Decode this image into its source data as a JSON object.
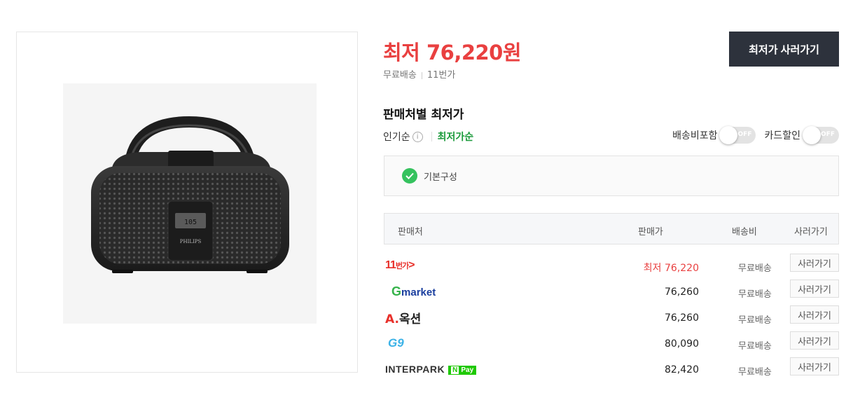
{
  "price": {
    "lowest_label": "최저 76,220원",
    "shipping": "무료배송",
    "store": "11번가"
  },
  "buy_button": "최저가 사러가기",
  "section_title": "판매처별 최저가",
  "sort": {
    "popular": "인기순",
    "info_glyph": "i",
    "lowest": "최저가순"
  },
  "toggles": [
    {
      "label": "배송비포함",
      "state": "OFF"
    },
    {
      "label": "카드할인",
      "state": "OFF"
    }
  ],
  "config": {
    "label": "기본구성"
  },
  "table": {
    "headers": {
      "seller": "판매처",
      "price": "판매가",
      "shipping": "배송비",
      "go": "사러가기"
    },
    "rows": [
      {
        "seller": "11번가",
        "logo_main": "11",
        "logo_sub": "번가",
        "price": "최저 76,220",
        "shipping": "무료배송",
        "go": "사러가기"
      },
      {
        "seller": "Gmarket",
        "logo_main": "G",
        "logo_sub": "market",
        "price": "76,260",
        "shipping": "무료배송",
        "go": "사러가기"
      },
      {
        "seller": "옥션",
        "logo_main": "A.",
        "logo_sub": "옥션",
        "price": "76,260",
        "shipping": "무료배송",
        "go": "사러가기"
      },
      {
        "seller": "G9",
        "logo_main": "G9",
        "logo_sub": "",
        "price": "80,090",
        "shipping": "무료배송",
        "go": "사러가기"
      },
      {
        "seller": "INTERPARK",
        "logo_main": "INTERPARK",
        "logo_sub": "Pay",
        "logo_badge": "N",
        "price": "82,420",
        "shipping": "무료배송",
        "go": "사러가기"
      }
    ]
  },
  "product_image": {
    "brand": "PHILIPS",
    "display": "105"
  },
  "colors": {
    "accent_red": "#e94040",
    "lowest_green": "#1a9a3a",
    "button_dark": "#2d323c",
    "check_green": "#35c25e"
  }
}
